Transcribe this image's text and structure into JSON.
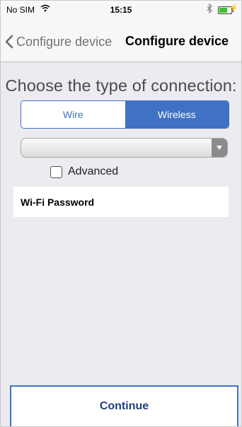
{
  "status_bar": {
    "carrier": "No SIM",
    "time": "15:15",
    "battery_level": 0.6,
    "icons": [
      "wifi-icon",
      "bluetooth-icon",
      "battery-icon",
      "charging-bolt-icon"
    ]
  },
  "nav": {
    "back_label": "Configure device",
    "title": "Configure device"
  },
  "heading": "Choose the type of connection:",
  "connection_type": {
    "options": [
      "Wire",
      "Wireless"
    ],
    "selected": "Wireless"
  },
  "network_picker": {
    "value": "",
    "icon": "dropdown-arrow-icon"
  },
  "advanced": {
    "label": "Advanced",
    "checked": false
  },
  "wifi_password": {
    "label": "Wi-Fi Password"
  },
  "continue_label": "Continue",
  "colors": {
    "accent": "#3f71c4",
    "background": "#ebebf0",
    "continue_text": "#1f3f7e"
  }
}
